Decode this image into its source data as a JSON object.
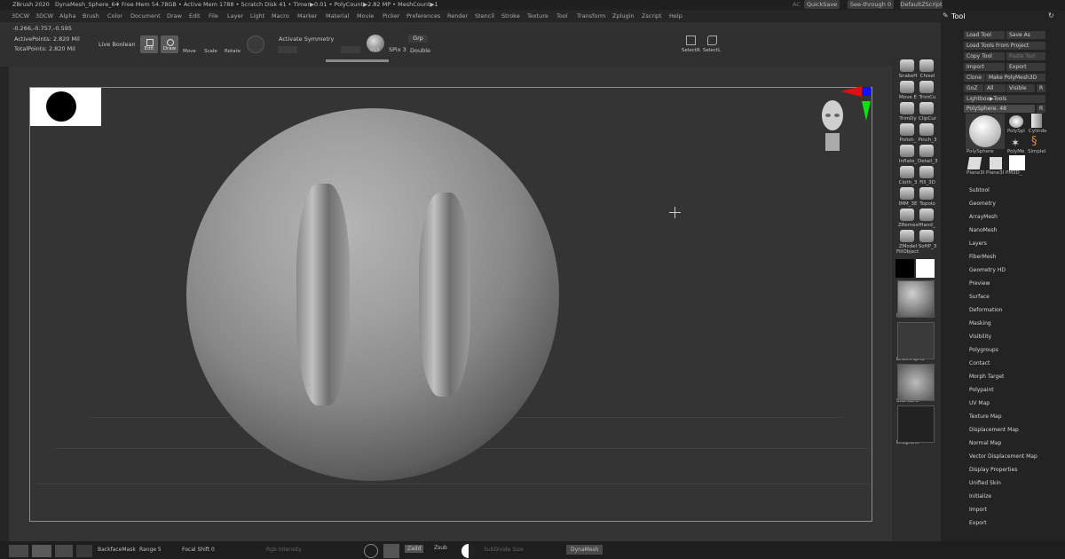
{
  "titlebar": {
    "app": "ZBrush 2020",
    "doc": "DynaMesh_Sphere_64",
    "stats": "• Free Mem 54.78GB • Active Mem 1788 • Scratch Disk 41 •  Timer▶0.01 • PolyCount▶2.82 MP  • MeshCount▶1",
    "ac": "AC",
    "quicksave": "QuickSave",
    "seethrough": "See-through  0",
    "script": "DefaultZScript"
  },
  "menus": [
    "3DCW",
    "3DCW",
    "Alpha",
    "Brush",
    "Color",
    "Document",
    "Draw",
    "Edit",
    "File",
    "Layer",
    "Light",
    "Macro",
    "Marker",
    "Material",
    "Movie",
    "Picker",
    "Preferences",
    "Render",
    "Stencil",
    "Stroke",
    "Texture",
    "Tool",
    "Transform",
    "Zplugin",
    "Zscript",
    "Help"
  ],
  "shelf": {
    "coords": "-0.266,-0.757,-0.595",
    "active_points": "ActivePoints: 2.820 Mil",
    "total_points": "TotalPoints: 2.820 Mil",
    "live_boolean": "Live Boolean",
    "edit": "Edit",
    "draw": "Draw",
    "move": "Move",
    "scale": "Scale",
    "rotate": "Rotate",
    "activate_symmetry": "Activate Symmetry",
    "rgb": "RGB",
    "spix": "SPix 3",
    "grp": "Grp",
    "double": "Double",
    "selectr": "SelectR",
    "selectl": "SelectL"
  },
  "rightstrip": {
    "items": [
      "SnakeH",
      "Chisel",
      "Move E",
      "TrimCu",
      "TrimDy",
      "ClipCur",
      "Polish_",
      "Pinch_3",
      "Inflate_",
      "Detail_3",
      "Cloth_3",
      "Fill_3D",
      "IMM_3E",
      "Topolo",
      "ZRemesh",
      "Hand_",
      "ZModel",
      "SoftP_3"
    ],
    "fillobject": "FillObject",
    "matcap": "MatCap Gray",
    "alpha": "BrushAlpha",
    "standard": "Standard",
    "dragrect": "DragRect"
  },
  "toolpanel": {
    "title": "Tool",
    "load_tool": "Load Tool",
    "save_as": "Save As",
    "load_project": "Load Tools From Project",
    "copy_tool": "Copy Tool",
    "paste_tool": "Paste Tool",
    "import": "Import",
    "export": "Export",
    "clone": "Clone",
    "make_polymesh": "Make PolyMesh3D",
    "goz": "GoZ",
    "all": "All",
    "visible": "Visible",
    "r": "R",
    "lightbox": "Lightbox▶Tools",
    "polysphere": "PolySphere. 48",
    "thumbs": [
      "PolySphere",
      "PolySpl",
      "Cylinde",
      "PolyMe",
      "SimpleI",
      "Plane3I",
      "Plane3I",
      "PM3D_"
    ],
    "subpalettes": [
      "Subtool",
      "Geometry",
      "ArrayMesh",
      "NanoMesh",
      "Layers",
      "FiberMesh",
      "Geometry HD",
      "Preview",
      "Surface",
      "Deformation",
      "Masking",
      "Visibility",
      "Polygroups",
      "Contact",
      "Morph Target",
      "Polypaint",
      "UV Map",
      "Texture Map",
      "Displacement Map",
      "Normal Map",
      "Vector Displacement Map",
      "Display Properties",
      "Unified Skin",
      "Initialize",
      "Import",
      "Export"
    ]
  },
  "bottombar": {
    "backface": "BackfaceMask",
    "range": "Range 5",
    "focal": "Focal Shift 0",
    "rgb_intensity": "Rgb Intensity",
    "zadd": "Zadd",
    "zsub": "Zsub",
    "subdivide": "SubDivide Size",
    "dynamesh": "DynaMesh"
  }
}
